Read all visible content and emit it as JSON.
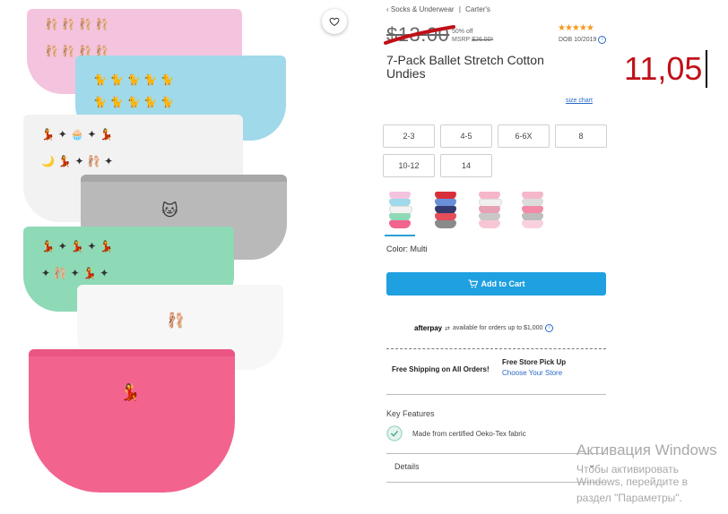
{
  "breadcrumb": {
    "back": "‹ Socks & Underwear",
    "separator": "|",
    "brand": "Carter's"
  },
  "price": {
    "old": "$13.00",
    "discount": "50% off",
    "msrp_label": "MSRP",
    "msrp_value": "$26.00*"
  },
  "rating": {
    "stars": "★★★★★",
    "date": "DOB 10/2019"
  },
  "product": {
    "title": "7-Pack Ballet Stretch Cotton Undies"
  },
  "overlay_number": "11,05",
  "size_chart": "size chart",
  "sizes": [
    "2-3",
    "4-5",
    "6-6X",
    "8",
    "10-12",
    "14"
  ],
  "color": {
    "label": "Color: Multi"
  },
  "add_to_cart": {
    "label": "Add to Cart",
    "icon": "cart-icon"
  },
  "afterpay": {
    "logo": "afterpay",
    "text": "available for orders up to $1,000"
  },
  "shipping": {
    "free_shipping": "Free Shipping on All Orders!",
    "pickup_title": "Free Store Pick Up",
    "pickup_link": "Choose Your Store"
  },
  "key_features": {
    "title": "Key Features",
    "item": "Made from certified Oeko-Tex fabric"
  },
  "details": {
    "label": "Details"
  },
  "windows_activation": {
    "line1": "Активация Windows",
    "line2": "Чтобы активировать Windows, перейдите в",
    "line3": "раздел \"Параметры\"."
  },
  "colors": {
    "accent": "#1fa0e0",
    "link": "#2a69c6",
    "star": "#f29a1a",
    "overlay": "#c01018"
  }
}
